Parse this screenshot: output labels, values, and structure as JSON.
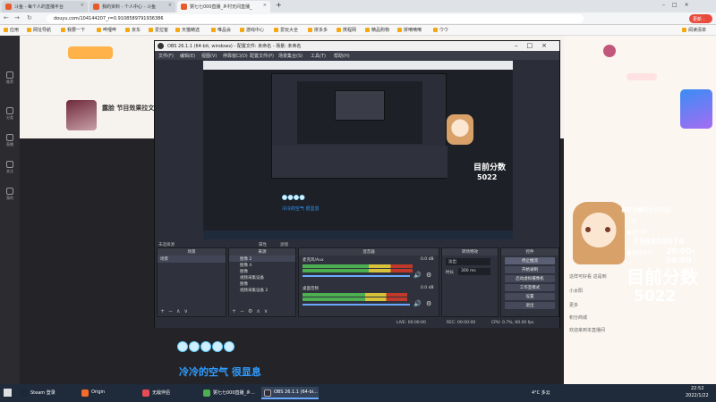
{
  "browser": {
    "tabs": [
      {
        "label": "斗鱼 - 每个人的直播平台",
        "active": false
      },
      {
        "label": "我的资料 - 个人中心 - 斗鱼",
        "active": false
      },
      {
        "label": "粥七七000直播_乡村无间直播_",
        "active": true
      }
    ],
    "url": "douyu.com/104144207_r=0.9108589791936386",
    "update_label": "更新 :",
    "bookmarks": [
      "应用",
      "网址导航",
      "我要一下",
      "哔哩哔",
      "京东",
      "爱拉客",
      "天猫精选",
      "唯品会",
      "游戏中心",
      "爱玩大全",
      "拼多多",
      "携程网",
      "精品购物",
      "拼嘀嘀嘀",
      "ウウ"
    ],
    "reading_list": "阅读清单"
  },
  "douyu": {
    "streamer_title": "露脸 节目效果拉文",
    "sidebar": [
      "推荐",
      "分类",
      "直播",
      "关注",
      "我的"
    ]
  },
  "obs": {
    "title": "OBS 26.1.1 (64-bit, windows) - 配置文件: 未命名 - 场景: 未命名",
    "menu": [
      "文件(F)",
      "编辑(E)",
      "视图(V)",
      "停靠窗口(D)",
      "配置文件(P)",
      "场景集合(S)",
      "工具(T)",
      "帮助(H)"
    ],
    "no_source": "未选择源",
    "props_label": "属性",
    "filters_label": "滤镜",
    "docks": {
      "scenes": "场景",
      "sources": "来源",
      "mixer": "混音器",
      "transitions": "转场特效",
      "controls": "控件"
    },
    "scene_items": [
      "场景"
    ],
    "source_items": [
      "图像 2",
      "图像 4",
      "图像",
      "视频采集设备",
      "图像",
      "视频采集设备 2"
    ],
    "mixer_tracks": [
      {
        "name": "麦克风/Aux",
        "db": "0.0 dB",
        "level": 0.82
      },
      {
        "name": "桌面音频",
        "db": "0.0 dB",
        "level": 0.78
      }
    ],
    "transition": {
      "type": "淡出",
      "duration_label": "时长",
      "duration": "300 ms"
    },
    "control_buttons": [
      "停止推流",
      "开始录制",
      "启动虚拟摄像机",
      "工作室模式",
      "设置",
      "退出"
    ],
    "status": {
      "live": "LIVE: 00:00:00",
      "rec": "REC: 00:00:00",
      "cpu": "CPU: 0.7%, 60.00 fps"
    }
  },
  "overlay": {
    "bubble_count": 5,
    "lyric": "冷冷的空气 很显息",
    "viewer_label": "目前分数",
    "viewer_count": "5022",
    "follow_text": "喜欢主播的点点关注~",
    "fan_label": "☆粉:",
    "fan_group": "●粉丝群",
    "group_number": "798808676",
    "live_time_label": "●直播时间:",
    "live_time": "20:00-06:00"
  },
  "chat": [
    "这样可好看 这是到",
    "小太阳",
    "更多",
    "积分商城",
    "欢迎来到本直播间"
  ],
  "taskbar": {
    "apps": [
      {
        "label": "Steam 登录",
        "color": "#1b2838"
      },
      {
        "label": "Origin",
        "color": "#f56c2d"
      },
      {
        "label": "无敌伴侣",
        "color": "#e94b55"
      },
      {
        "label": "粥七七000直播_乡...",
        "color": "#4caf50"
      },
      {
        "label": "OBS 26.1.1 (64-bi...",
        "color": "#302e3b"
      }
    ],
    "temp": "4°C 多云",
    "time": "22:52",
    "date": "2022/1/22"
  }
}
